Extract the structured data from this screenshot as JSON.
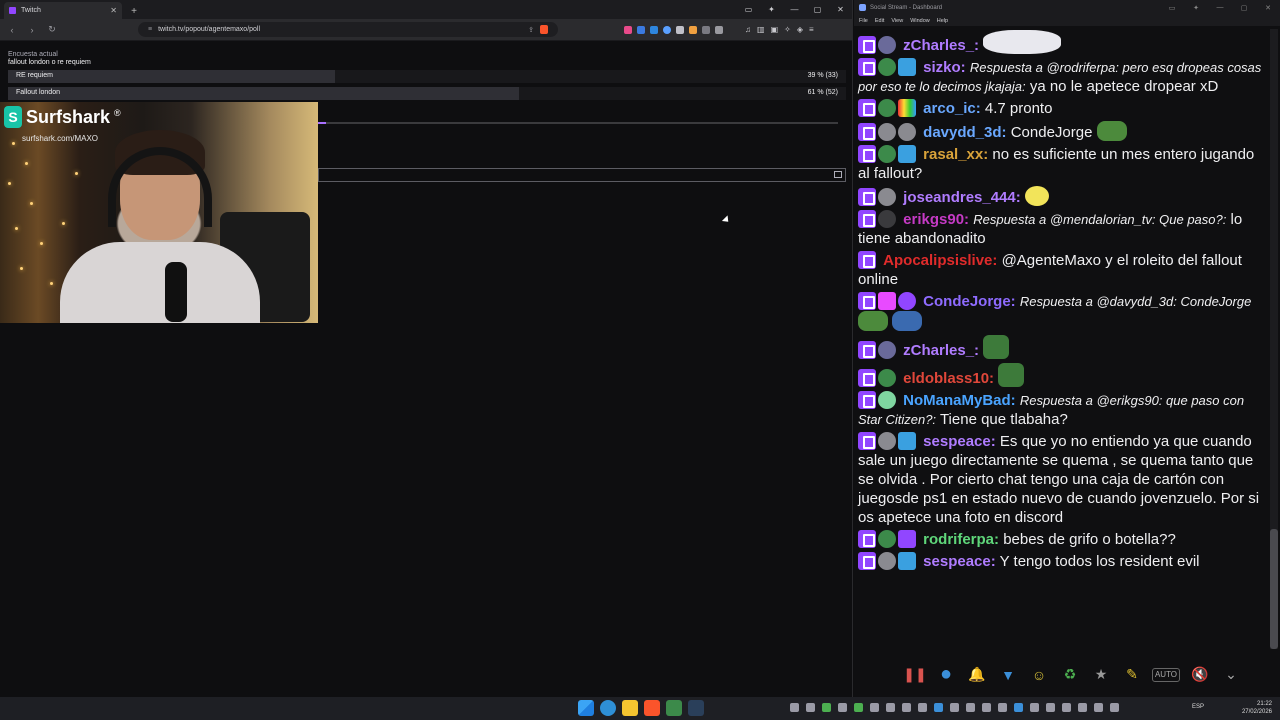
{
  "browser": {
    "tab_title": "Twitch",
    "tab_close": "✕",
    "new_tab": "+",
    "window_controls": [
      "▭",
      "✦",
      "—",
      "▢",
      "✕"
    ],
    "url": "twitch.tv/popout/agentemaxo/poll",
    "nav_back": "‹",
    "nav_forward": "›",
    "nav_reload": "↻"
  },
  "poll": {
    "label": "Encuesta actual",
    "question": "fallout london o re requiem",
    "options": [
      {
        "name": "RE requiem",
        "percent_label": "39 % (33)",
        "percent": 39
      },
      {
        "name": "Fallout london",
        "percent_label": "61 % (52)",
        "percent": 61
      }
    ]
  },
  "webcam": {
    "sponsor_name": "Surfshark",
    "sponsor_reg": "®",
    "sponsor_logo_letter": "S",
    "sponsor_url": "surfshark.com/MAXO"
  },
  "chat_window": {
    "title": "Social Stream - Dashboard",
    "menu": [
      "File",
      "Edit",
      "View",
      "Window",
      "Help"
    ],
    "title_controls": [
      "▭",
      "✦",
      "—",
      "▢",
      "✕"
    ]
  },
  "chat": {
    "messages": [
      {
        "user": "zCharles_:",
        "user_color": "#b07cff",
        "text": ""
      },
      {
        "user": "sizko:",
        "user_color": "#b07cff",
        "reply": "Respuesta a @rodriferpa: pero esq dropeas cosas por eso te lo decimos jkajaja:",
        "text": "ya no le apetece dropear xD"
      },
      {
        "user": "arco_ic:",
        "user_color": "#6aa8ff",
        "text": "4.7 pronto"
      },
      {
        "user": "davydd_3d:",
        "user_color": "#6aa8ff",
        "text": "CondeJorge"
      },
      {
        "user": "rasal_xx:",
        "user_color": "#d8a23a",
        "text": "no es suficiente un mes entero jugando al fallout?"
      },
      {
        "user": "joseandres_444:",
        "user_color": "#b07cff",
        "text": ""
      },
      {
        "user": "erikgs90:",
        "user_color": "#c53ac5",
        "reply": "Respuesta a @mendalorian_tv: Que paso?:",
        "text": "lo tiene abandonadito"
      },
      {
        "user": "Apocalipsislive:",
        "user_color": "#e02b2b",
        "text": "@AgenteMaxo y el roleito del fallout online"
      },
      {
        "user": "CondeJorge:",
        "user_color": "#8e6bff",
        "reply": "Respuesta a @davydd_3d: CondeJorge",
        "text": ""
      },
      {
        "user": "zCharles_:",
        "user_color": "#b07cff",
        "text": ""
      },
      {
        "user": "eldoblass10:",
        "user_color": "#e0473a",
        "text": ""
      },
      {
        "user": "NoManaMyBad:",
        "user_color": "#4aa4ff",
        "reply": "Respuesta a @erikgs90: que paso con Star Citizen?:",
        "text": "Tiene que tlabaha?"
      },
      {
        "user": "sespeace:",
        "user_color": "#b07cff",
        "text": "Es que yo no entiendo ya que cuando sale un juego directamente se quema , se quema tanto que se olvida . Por cierto chat tengo una caja de cartón con juegosde ps1 en estado nuevo de cuando jovenzuelo. Por si os apetece una foto en discord"
      },
      {
        "user": "rodriferpa:",
        "user_color": "#5fd77a",
        "text": "bebes de grifo o botella??"
      },
      {
        "user": "sespeace:",
        "user_color": "#b07cff",
        "text": "Y tengo todos los resident evil"
      }
    ]
  },
  "toolbar_buttons": [
    {
      "name": "pause-icon",
      "glyph": "❚❚",
      "color": "#d9534f"
    },
    {
      "name": "chat-bubble-icon",
      "glyph": "●",
      "color": "#3b8fd9"
    },
    {
      "name": "bell-icon",
      "glyph": "🔔",
      "color": "#d9a03a"
    },
    {
      "name": "filter-icon",
      "glyph": "▼",
      "color": "#3b8fd9"
    },
    {
      "name": "emoji-icon",
      "glyph": "☺",
      "color": "#d9c23a"
    },
    {
      "name": "recycle-icon",
      "glyph": "♻",
      "color": "#4caf50"
    },
    {
      "name": "star-icon",
      "glyph": "★",
      "color": "#999"
    },
    {
      "name": "broom-icon",
      "glyph": "✎",
      "color": "#e0c030"
    },
    {
      "name": "auto-icon",
      "glyph": "AUTO",
      "color": "#aaa"
    },
    {
      "name": "mute-icon",
      "glyph": "🔇",
      "color": "#aaa"
    },
    {
      "name": "collapse-icon",
      "glyph": "⌄",
      "color": "#aaa"
    }
  ],
  "taskbar": {
    "language": "ESP",
    "time": "21:22",
    "date": "27/02/2026"
  }
}
